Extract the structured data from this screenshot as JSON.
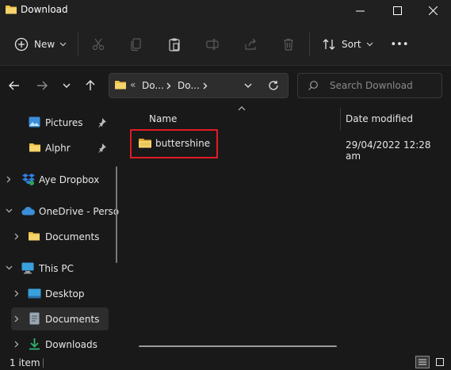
{
  "window": {
    "title": "Download"
  },
  "toolbar": {
    "new_label": "New",
    "sort_label": "Sort",
    "more_label": "•••"
  },
  "address": {
    "crumbs": [
      "Do...",
      "Do..."
    ],
    "overflow": "«"
  },
  "search": {
    "placeholder": "Search Download"
  },
  "sidebar": {
    "items": [
      {
        "label": "Pictures",
        "icon": "pictures-icon",
        "pinned": true
      },
      {
        "label": "Alphr",
        "icon": "folder-icon",
        "pinned": true
      },
      {
        "label": "Aye Dropbox",
        "icon": "dropbox-icon"
      },
      {
        "label": "OneDrive - Perso",
        "icon": "onedrive-icon"
      },
      {
        "label": "Documents",
        "icon": "folder-icon"
      },
      {
        "label": "This PC",
        "icon": "pc-icon"
      },
      {
        "label": "Desktop",
        "icon": "desktop-icon"
      },
      {
        "label": "Documents",
        "icon": "documents-icon",
        "selected": true
      },
      {
        "label": "Downloads",
        "icon": "downloads-icon"
      }
    ]
  },
  "content": {
    "columns": {
      "name": "Name",
      "date": "Date modified"
    },
    "files": [
      {
        "name": "buttershine",
        "date": "29/04/2022 12:28 am",
        "type": "folder"
      }
    ]
  },
  "status": {
    "count": "1 item"
  },
  "colors": {
    "highlight": "#e01b24",
    "folder": "#f0c14b",
    "accent": "#4ea1e8"
  }
}
